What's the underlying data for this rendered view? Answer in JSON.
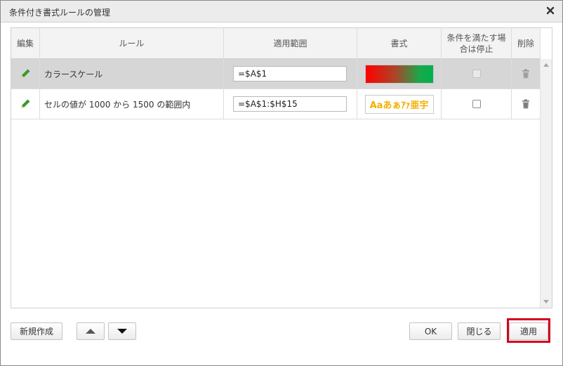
{
  "dialog": {
    "title": "条件付き書式ルールの管理"
  },
  "table": {
    "headers": {
      "edit": "編集",
      "rule": "ルール",
      "range": "適用範囲",
      "format": "書式",
      "stop": "条件を満たす場合は停止",
      "delete": "削除"
    },
    "rows": [
      {
        "rule": "カラースケール",
        "range": "=$A$1",
        "format_type": "color-scale",
        "stop_checked": false,
        "stop_enabled": false,
        "selected": true
      },
      {
        "rule": "セルの値が 1000 から 1500 の範囲内",
        "range": "=$A$1:$H$15",
        "format_type": "text-style",
        "format_preview": "Aaあぁｱｧ亜宇",
        "stop_checked": false,
        "stop_enabled": true,
        "selected": false
      }
    ]
  },
  "buttons": {
    "new_rule": "新規作成",
    "move_up": "up-arrow",
    "move_down": "down-arrow",
    "ok": "OK",
    "close": "閉じる",
    "apply": "適用"
  },
  "colors": {
    "header_bg": "#f3f3f3",
    "selected_row": "#d6d6d6",
    "highlight_border": "#d0021b",
    "color_scale_start": "#ff0000",
    "color_scale_end": "#00b050",
    "preview_text": "#f0b000"
  }
}
